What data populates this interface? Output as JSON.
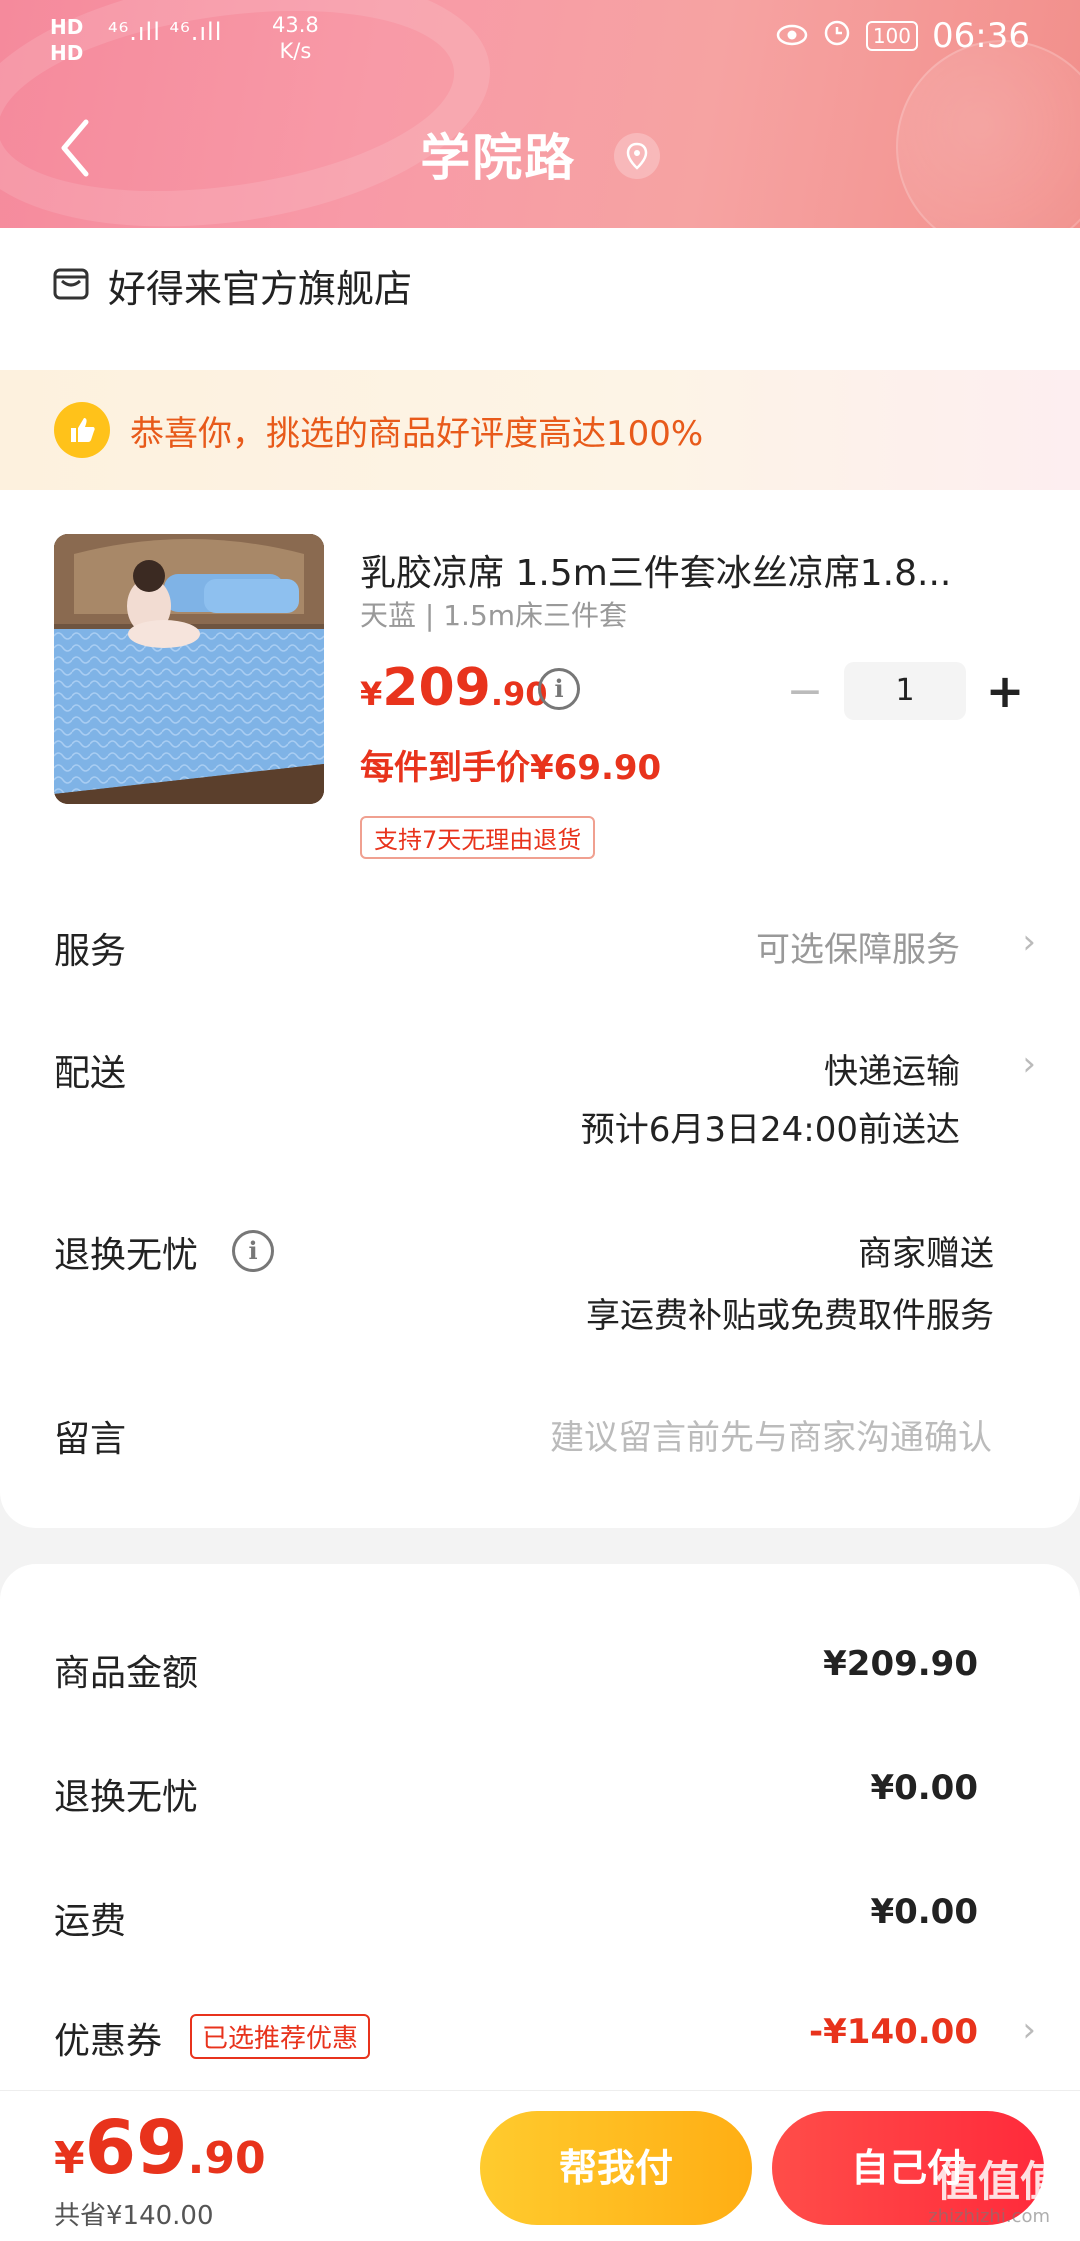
{
  "status_bar": {
    "hd1": "HD",
    "hd2": "HD",
    "signal": "⁴⁶.ıll ⁴⁶.ıll",
    "speed_value": "43.8",
    "speed_unit": "K/s",
    "battery": "100",
    "time": "06:36"
  },
  "header": {
    "title": "学院路"
  },
  "store": {
    "name": "好得来官方旗舰店"
  },
  "praise": {
    "text": "恭喜你，挑选的商品好评度高达100%"
  },
  "product": {
    "title": "乳胶凉席 1.5m三件套冰丝凉席1.8...",
    "spec": "天蓝 | 1.5m床三件套",
    "price_currency": "¥",
    "price_int": "209",
    "price_dec": ".90",
    "quantity": "1",
    "minus": "−",
    "plus": "+",
    "unit_price_text": "每件到手价¥69.90",
    "return_badge": "支持7天无理由退货"
  },
  "rows": {
    "service_label": "服务",
    "service_value": "可选保障服务",
    "delivery_label": "配送",
    "delivery_value": "快递运输",
    "delivery_eta": "预计6月3日24:00前送达",
    "worry_label": "退换无忧",
    "worry_value": "商家赠送",
    "worry_desc": "享运费补贴或免费取件服务",
    "note_label": "留言",
    "note_placeholder": "建议留言前先与商家沟通确认"
  },
  "summary": {
    "goods_label": "商品金额",
    "goods_value": "¥209.90",
    "worry_label": "退换无忧",
    "worry_value": "¥0.00",
    "freight_label": "运费",
    "freight_value": "¥0.00",
    "coupon_label": "优惠券",
    "coupon_badge": "已选推荐优惠",
    "coupon_value": "-¥140.00"
  },
  "bottom": {
    "total_currency": "¥",
    "total_int": "69",
    "total_dec": ".90",
    "saved": "共省¥140.00",
    "help_pay": "帮我付",
    "self_pay": "自己付",
    "watermark": "值值值",
    "watermark_url": "zhizhizhi.com"
  },
  "colors": {
    "accent_red": "#e8331c",
    "header_pink": "#f89aa7",
    "help_yellow": "#ffb81f",
    "praise_orange": "#e85a1a"
  }
}
